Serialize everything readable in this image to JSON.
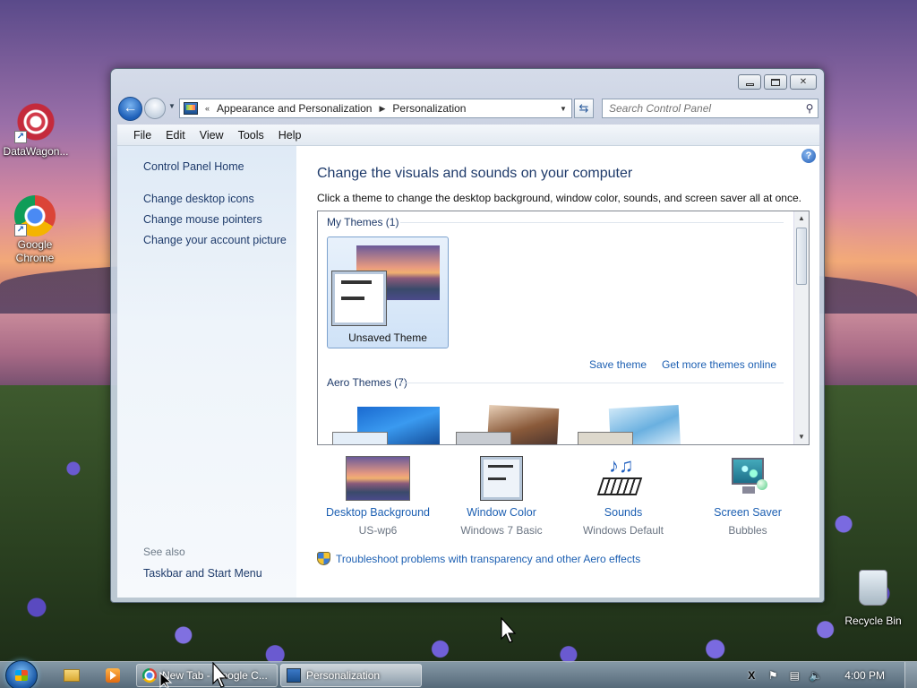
{
  "desktop": {
    "icons": [
      {
        "label": "DataWagon...",
        "icon": "datawagon-icon"
      },
      {
        "label": "Google Chrome",
        "icon": "chrome-icon"
      },
      {
        "label": "Recycle Bin",
        "icon": "recycle-bin-icon"
      }
    ]
  },
  "window": {
    "breadcrumb": [
      "Appearance and Personalization",
      "Personalization"
    ],
    "breadcrumb_prefix": "«",
    "search_placeholder": "Search Control Panel",
    "menu": [
      "File",
      "Edit",
      "View",
      "Tools",
      "Help"
    ],
    "left_pane": {
      "home": "Control Panel Home",
      "links": [
        "Change desktop icons",
        "Change mouse pointers",
        "Change your account picture"
      ],
      "see_also_title": "See also",
      "see_also_links": [
        "Taskbar and Start Menu"
      ]
    },
    "main": {
      "heading": "Change the visuals and sounds on your computer",
      "subtext": "Click a theme to change the desktop background, window color, sounds, and screen saver all at once.",
      "my_themes_title": "My Themes (1)",
      "selected_theme": "Unsaved Theme",
      "save_theme": "Save theme",
      "get_more": "Get more themes online",
      "aero_themes_title": "Aero Themes (7)",
      "settings": [
        {
          "title": "Desktop Background",
          "value": "US-wp6",
          "icon": "desktop-background-icon"
        },
        {
          "title": "Window Color",
          "value": "Windows 7 Basic",
          "icon": "window-color-icon"
        },
        {
          "title": "Sounds",
          "value": "Windows Default",
          "icon": "sounds-icon"
        },
        {
          "title": "Screen Saver",
          "value": "Bubbles",
          "icon": "screen-saver-icon"
        }
      ],
      "troubleshoot": "Troubleshoot problems with transparency and other Aero effects"
    }
  },
  "taskbar": {
    "tasks": [
      {
        "label": "New Tab - Google C...",
        "icon": "chrome-icon"
      },
      {
        "label": "Personalization",
        "icon": "control-panel-icon"
      }
    ],
    "clock": "4:00 PM"
  }
}
